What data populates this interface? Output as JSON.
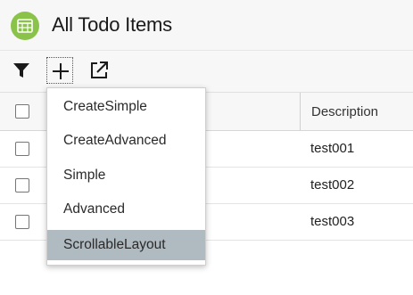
{
  "header": {
    "title": "All Todo Items",
    "icon": "calendar-icon"
  },
  "toolbar": {
    "filter_icon": "filter-icon",
    "add_icon": "plus-icon",
    "export_icon": "export-icon"
  },
  "table": {
    "columns": [
      "Description"
    ],
    "rows": [
      {
        "description": "test001"
      },
      {
        "description": "test002"
      },
      {
        "description": "test003"
      }
    ]
  },
  "menu": {
    "items": [
      {
        "label": "CreateSimple"
      },
      {
        "label": "CreateAdvanced"
      },
      {
        "label": "Simple"
      },
      {
        "label": "Advanced"
      },
      {
        "label": "ScrollableLayout",
        "selected": true
      }
    ]
  },
  "colors": {
    "accent": "#8bc34a",
    "menu_selected": "#b0bac1"
  }
}
